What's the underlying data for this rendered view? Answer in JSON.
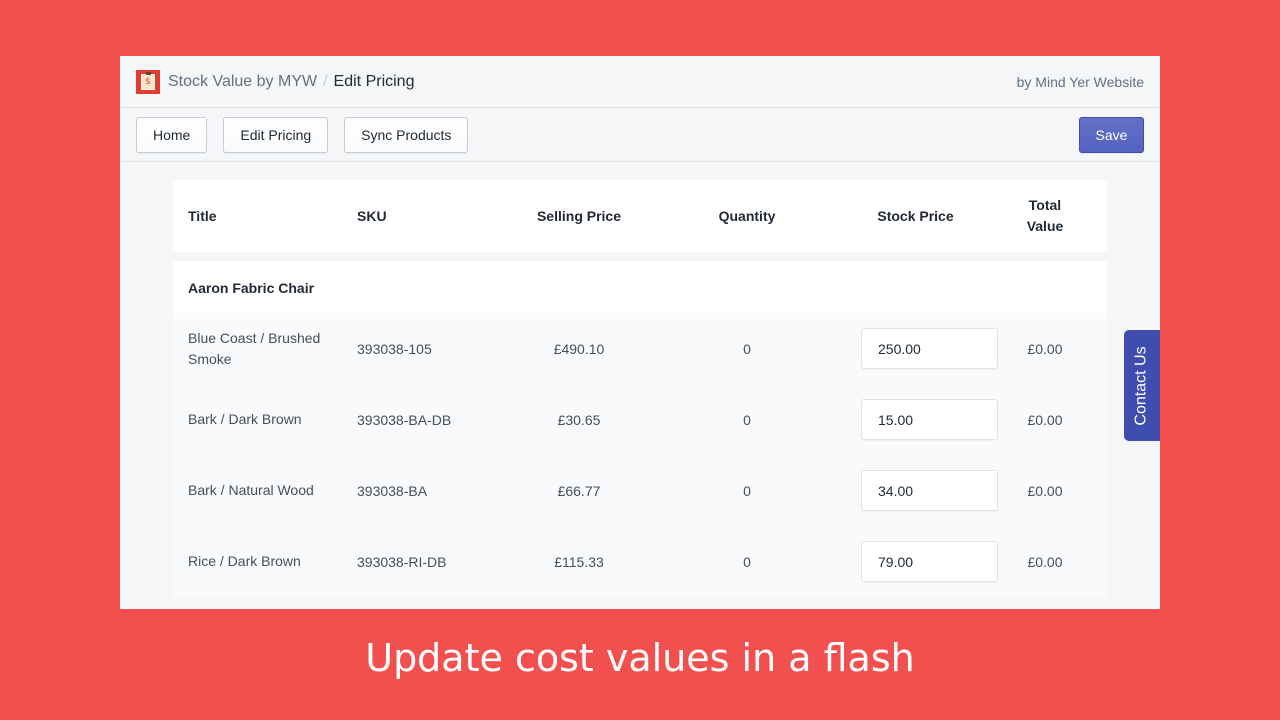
{
  "app": {
    "name": "Stock Value by MYW",
    "separator": "/",
    "current_page": "Edit Pricing",
    "by_line": "by Mind Yer Website",
    "logo_icon": "clipboard-dollar-icon",
    "logo_glyph": "$"
  },
  "toolbar": {
    "home_label": "Home",
    "edit_pricing_label": "Edit Pricing",
    "sync_products_label": "Sync Products",
    "save_label": "Save"
  },
  "table": {
    "headers": {
      "title": "Title",
      "sku": "SKU",
      "selling_price": "Selling Price",
      "quantity": "Quantity",
      "stock_price": "Stock Price",
      "total_value_line1": "Total",
      "total_value_line2": "Value"
    },
    "group": "Aaron Fabric Chair",
    "rows": [
      {
        "title": "Blue Coast / Brushed Smoke",
        "sku": "393038-105",
        "selling_price": "£490.10",
        "quantity": "0",
        "stock_price": "250.00",
        "total_value": "£0.00"
      },
      {
        "title": "Bark / Dark Brown",
        "sku": "393038-BA-DB",
        "selling_price": "£30.65",
        "quantity": "0",
        "stock_price": "15.00",
        "total_value": "£0.00"
      },
      {
        "title": "Bark / Natural Wood",
        "sku": "393038-BA",
        "selling_price": "£66.77",
        "quantity": "0",
        "stock_price": "34.00",
        "total_value": "£0.00"
      },
      {
        "title": "Rice / Dark Brown",
        "sku": "393038-RI-DB",
        "selling_price": "£115.33",
        "quantity": "0",
        "stock_price": "79.00",
        "total_value": "£0.00"
      }
    ]
  },
  "contact_tab": {
    "label": "Contact Us"
  },
  "caption": "Update cost values in a flash",
  "colors": {
    "background": "#f2504e",
    "primary": "#5c6ac4",
    "contact": "#3f4eae"
  }
}
